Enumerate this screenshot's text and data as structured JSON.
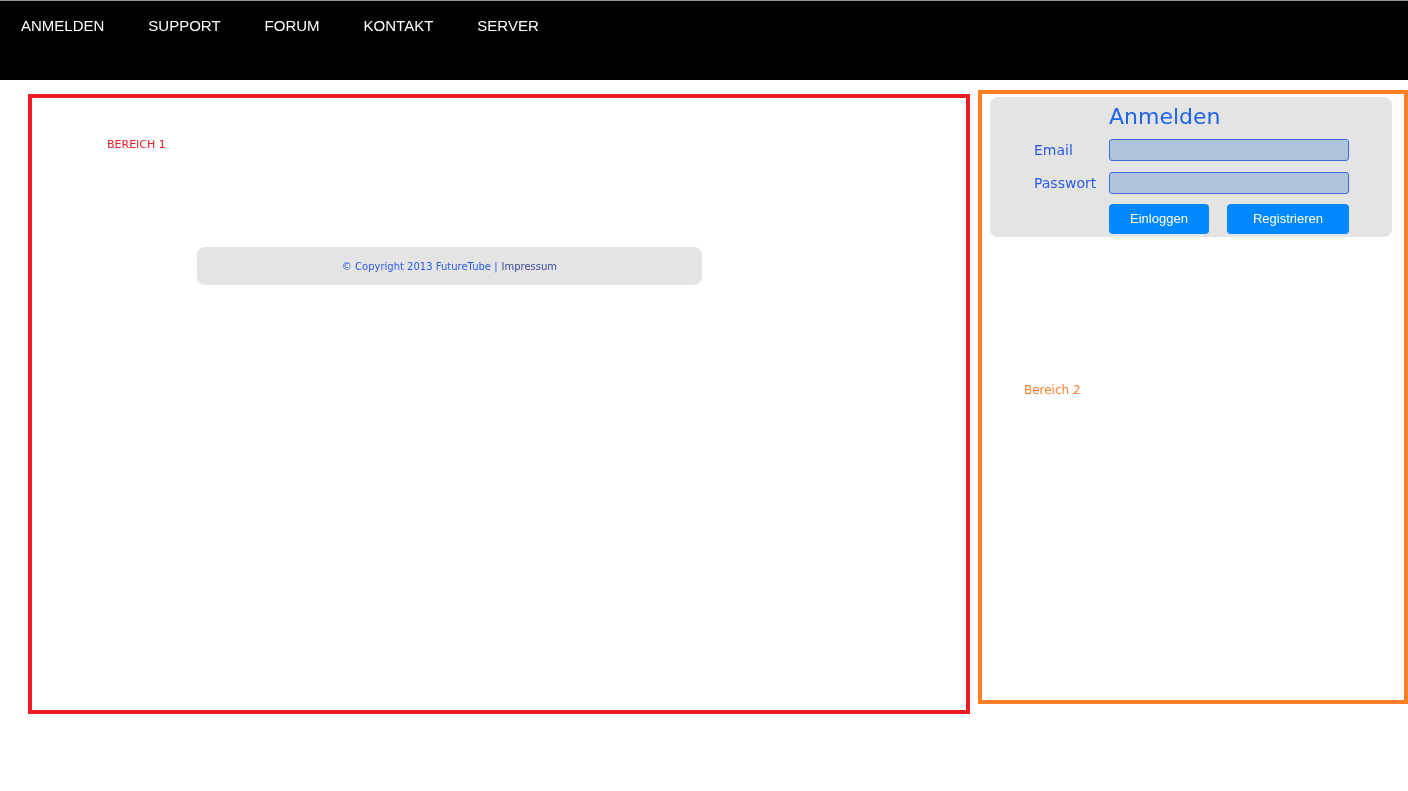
{
  "nav": {
    "items": [
      "ANMELDEN",
      "SUPPORT",
      "FORUM",
      "KONTAKT",
      "SERVER"
    ]
  },
  "bereich_1": {
    "label": "BEREICH 1",
    "footer": {
      "text": "© Copyright 2013 FutureTube |",
      "link": "Impressum"
    }
  },
  "bereich_2": {
    "label": "Bereich 2",
    "login": {
      "title": "Anmelden",
      "fields": [
        {
          "label": "Email"
        },
        {
          "label": "Passwort"
        }
      ],
      "buttons": [
        "Einloggen",
        "Registrieren"
      ]
    }
  }
}
